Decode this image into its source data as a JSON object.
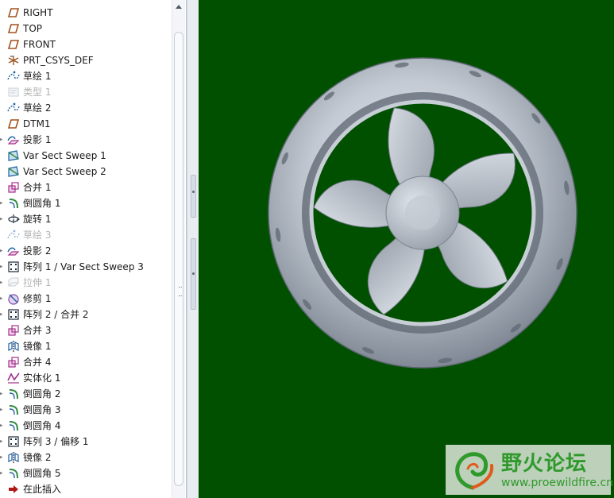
{
  "model_tree": {
    "items": [
      {
        "label": "RIGHT",
        "icon": "datum-plane-icon",
        "suppressed": false,
        "expandable": false
      },
      {
        "label": "TOP",
        "icon": "datum-plane-icon",
        "suppressed": false,
        "expandable": false
      },
      {
        "label": "FRONT",
        "icon": "datum-plane-icon",
        "suppressed": false,
        "expandable": false
      },
      {
        "label": "PRT_CSYS_DEF",
        "icon": "coordinate-system-icon",
        "suppressed": false,
        "expandable": false
      },
      {
        "label": "草绘 1",
        "icon": "sketch-icon",
        "suppressed": false,
        "expandable": false
      },
      {
        "label": "类型 1",
        "icon": "type-feature-icon",
        "suppressed": true,
        "expandable": false
      },
      {
        "label": "草绘 2",
        "icon": "sketch-icon",
        "suppressed": false,
        "expandable": false
      },
      {
        "label": "DTM1",
        "icon": "datum-plane-icon",
        "suppressed": false,
        "expandable": false
      },
      {
        "label": "投影 1",
        "icon": "projection-icon",
        "suppressed": false,
        "expandable": true
      },
      {
        "label": "Var Sect Sweep 1",
        "icon": "var-sect-sweep-icon",
        "suppressed": false,
        "expandable": false
      },
      {
        "label": "Var Sect Sweep 2",
        "icon": "var-sect-sweep-icon",
        "suppressed": false,
        "expandable": false
      },
      {
        "label": "合并 1",
        "icon": "merge-icon",
        "suppressed": false,
        "expandable": false
      },
      {
        "label": "倒圆角 1",
        "icon": "round-icon",
        "suppressed": false,
        "expandable": true
      },
      {
        "label": "旋转 1",
        "icon": "revolve-icon",
        "suppressed": false,
        "expandable": true
      },
      {
        "label": "草绘 3",
        "icon": "sketch-icon",
        "suppressed": true,
        "expandable": false
      },
      {
        "label": "投影 2",
        "icon": "projection-icon",
        "suppressed": false,
        "expandable": true
      },
      {
        "label": "阵列 1 / Var Sect Sweep 3",
        "icon": "pattern-icon",
        "suppressed": false,
        "expandable": true
      },
      {
        "label": "拉伸 1",
        "icon": "extrude-icon",
        "suppressed": true,
        "expandable": true
      },
      {
        "label": "修剪 1",
        "icon": "trim-icon",
        "suppressed": false,
        "expandable": true
      },
      {
        "label": "阵列 2 / 合并 2",
        "icon": "pattern-icon",
        "suppressed": false,
        "expandable": true
      },
      {
        "label": "合并 3",
        "icon": "merge-icon",
        "suppressed": false,
        "expandable": false
      },
      {
        "label": "镜像 1",
        "icon": "mirror-icon",
        "suppressed": false,
        "expandable": false
      },
      {
        "label": "合并 4",
        "icon": "merge-icon",
        "suppressed": false,
        "expandable": false
      },
      {
        "label": "实体化 1",
        "icon": "solidify-icon",
        "suppressed": false,
        "expandable": false
      },
      {
        "label": "倒圆角 2",
        "icon": "round-icon",
        "suppressed": false,
        "expandable": true
      },
      {
        "label": "倒圆角 3",
        "icon": "round-icon",
        "suppressed": false,
        "expandable": true
      },
      {
        "label": "倒圆角 4",
        "icon": "round-icon",
        "suppressed": false,
        "expandable": true
      },
      {
        "label": "阵列 3 / 偏移 1",
        "icon": "pattern-icon",
        "suppressed": false,
        "expandable": true
      },
      {
        "label": "镜像 2",
        "icon": "mirror-icon",
        "suppressed": false,
        "expandable": true
      },
      {
        "label": "倒圆角 5",
        "icon": "round-icon",
        "suppressed": false,
        "expandable": true
      },
      {
        "label": "在此插入",
        "icon": "insert-here-arrow-icon",
        "suppressed": false,
        "expandable": false
      }
    ]
  },
  "viewport": {
    "background": "#005000",
    "model": "wheel-icon"
  },
  "watermark": {
    "title": "野火论坛",
    "url": "www.proewildfire.cn",
    "logo": "forum-logo-icon",
    "color": "#2f9a2b"
  }
}
